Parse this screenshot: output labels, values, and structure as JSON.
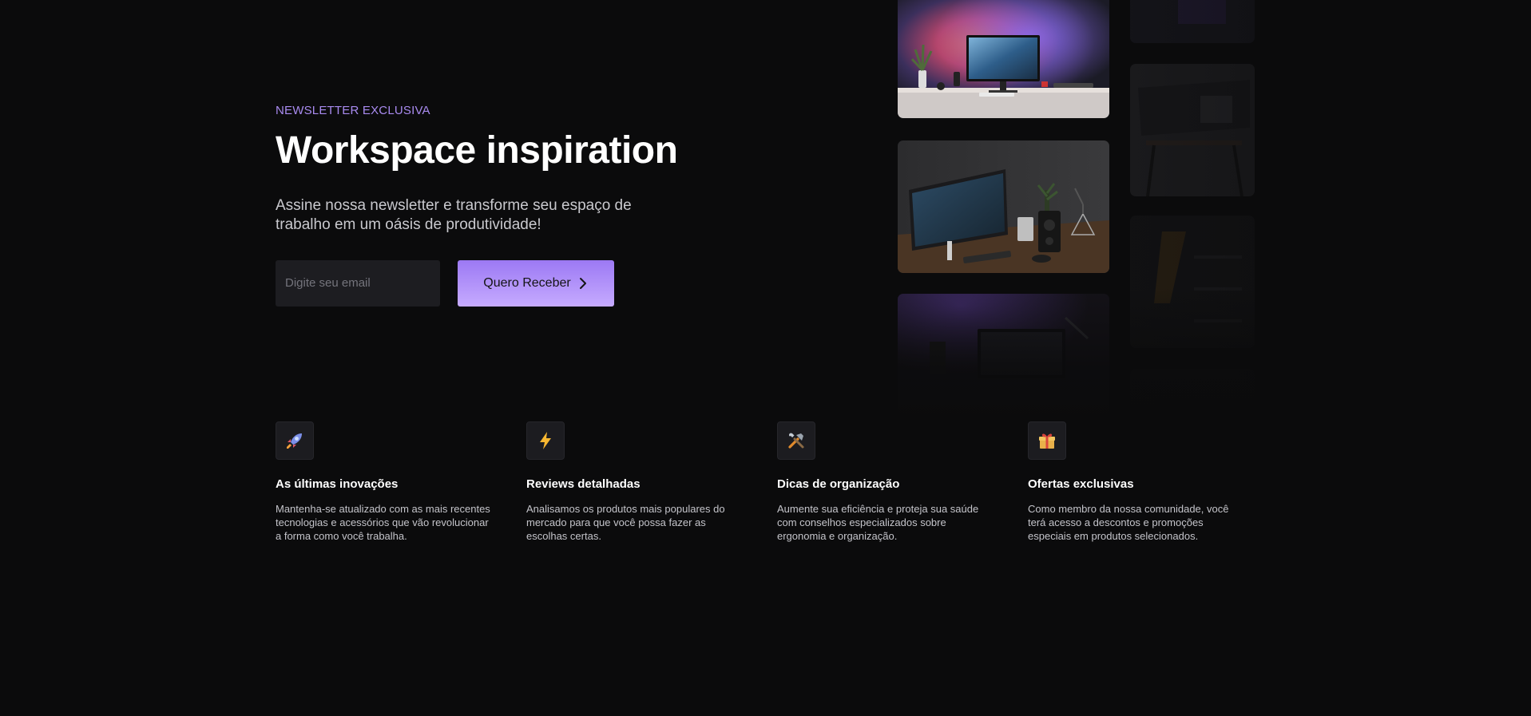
{
  "hero": {
    "eyebrow": "NEWSLETTER EXCLUSIVA",
    "title": "Workspace inspiration",
    "subtitle": "Assine nossa newsletter e transforme seu espaço de trabalho em um oásis de produtividade!",
    "email_placeholder": "Digite seu email",
    "cta_label": "Quero Receber",
    "cta_icon": "chevron-right-icon"
  },
  "gallery": {
    "images": [
      "desk-rgb-monitor-photo",
      "desk-monitor-speaker-photo",
      "dark-desk-setup-photo",
      "dim-desk-photo",
      "dim-shelf-photo"
    ]
  },
  "features": [
    {
      "icon": "rocket-icon",
      "title": "As últimas inovações",
      "description": "Mantenha-se atualizado com as mais recentes tecnologias e acessórios que vão revolucionar a forma como você trabalha."
    },
    {
      "icon": "lightning-icon",
      "title": "Reviews detalhadas",
      "description": "Analisamos os produtos mais populares do mercado para que você possa fazer as escolhas certas."
    },
    {
      "icon": "tools-icon",
      "title": "Dicas de organização",
      "description": "Aumente sua eficiência e proteja sua saúde com conselhos especializados sobre ergonomia e organização."
    },
    {
      "icon": "gift-icon",
      "title": "Ofertas exclusivas",
      "description": "Como membro da nossa comunidade, você terá acesso a descontos e promoções especiais em produtos selecionados."
    }
  ],
  "colors": {
    "background": "#0b0b0c",
    "accent": "#a98bf0",
    "cta_gradient_start": "#9c79f4",
    "cta_gradient_end": "#c6abff",
    "input_bg": "#1d1d21"
  }
}
